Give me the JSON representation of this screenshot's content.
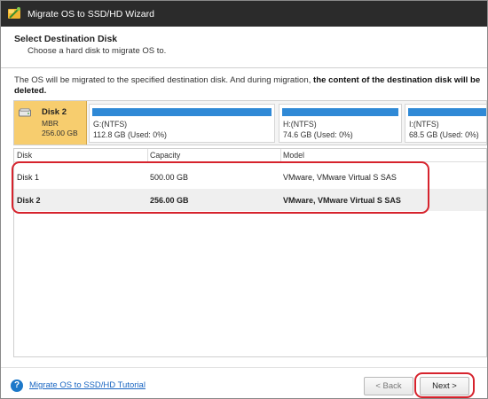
{
  "window": {
    "title": "Migrate OS to SSD/HD Wizard"
  },
  "header": {
    "title": "Select Destination Disk",
    "subtitle": "Choose a hard disk to migrate OS to."
  },
  "notice": {
    "line1_prefix": "The OS will be migrated to the specified destination disk. And during migration,",
    "line1_bold": "the content of the destination disk will be",
    "line2_bold": "deleted."
  },
  "disk_map": {
    "disk": {
      "name": "Disk 2",
      "type": "MBR",
      "size": "256.00 GB"
    },
    "partitions": [
      {
        "label": "G:(NTFS)",
        "info": "112.8 GB (Used: 0%)"
      },
      {
        "label": "H:(NTFS)",
        "info": "74.6 GB (Used: 0%)"
      },
      {
        "label": "I:(NTFS)",
        "info": "68.5 GB (Used: 0%)"
      }
    ]
  },
  "table": {
    "columns": [
      "Disk",
      "Capacity",
      "Model"
    ],
    "rows": [
      {
        "disk": "Disk 1",
        "capacity": "500.00 GB",
        "model": "VMware, VMware Virtual S SAS",
        "selected": false
      },
      {
        "disk": "Disk 2",
        "capacity": "256.00 GB",
        "model": "VMware, VMware Virtual S SAS",
        "selected": true
      }
    ]
  },
  "footer": {
    "tutorial_link": "Migrate OS to SSD/HD Tutorial",
    "back_label": "< Back",
    "next_label": "Next >"
  },
  "icons": {
    "app": "wizard-app-icon",
    "disk": "hard-disk-icon",
    "help": "help-icon"
  },
  "colors": {
    "titlebar": "#2b2b2b",
    "selected_disk": "#f7cd6e",
    "partition_bar": "#2f89d6",
    "highlight": "#d6232d",
    "link": "#1a66c2"
  }
}
